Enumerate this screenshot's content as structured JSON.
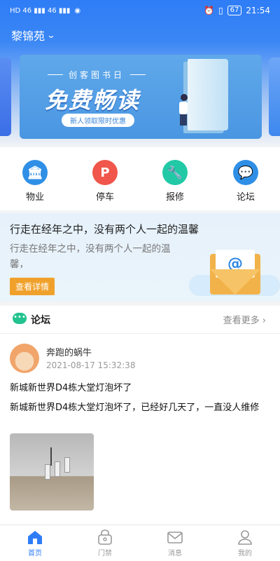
{
  "status_bar": {
    "left_glyphs": "HD 46 ▮▮▮ 46 ▮▮▮",
    "battery": "67",
    "time": "21:54"
  },
  "header": {
    "location": "黎锦苑"
  },
  "banner": {
    "subtitle": "创客图书日",
    "title": "免费畅读",
    "pill": "新人领取限时优惠"
  },
  "quick_menu": [
    {
      "label": "物业",
      "icon": "building-icon",
      "color": "#2f8fe6",
      "glyph": "🏛"
    },
    {
      "label": "停车",
      "icon": "parking-icon",
      "color": "#f0564b",
      "glyph": "P"
    },
    {
      "label": "报修",
      "icon": "wrench-icon",
      "color": "#21c9a6",
      "glyph": "🔧"
    },
    {
      "label": "论坛",
      "icon": "chat-icon",
      "color": "#2f8fe6",
      "glyph": "💬"
    }
  ],
  "promo": {
    "headline": "行走在经年之中，没有两个人一起的温馨",
    "description": "行走在经年之中，没有两个人一起的温馨，",
    "button": "查看详情",
    "envelope_glyph": "@"
  },
  "forum": {
    "title": "论坛",
    "more": "查看更多 ›",
    "post": {
      "author": "奔跑的蜗牛",
      "time": "2021-08-17 15:32:38",
      "title": "新城新世界D4栋大堂灯泡坏了",
      "body": "新城新世界D4栋大堂灯泡坏了，已经好几天了，一直没人维修"
    }
  },
  "tabbar": [
    {
      "label": "首页",
      "icon": "home-icon",
      "active": true
    },
    {
      "label": "门禁",
      "icon": "lock-icon",
      "active": false
    },
    {
      "label": "消息",
      "icon": "mail-icon",
      "active": false
    },
    {
      "label": "我的",
      "icon": "user-icon",
      "active": false
    }
  ],
  "colors": {
    "primary": "#2f7df6",
    "accent_button": "#f0a12b",
    "forum_icon": "#22c38e"
  }
}
